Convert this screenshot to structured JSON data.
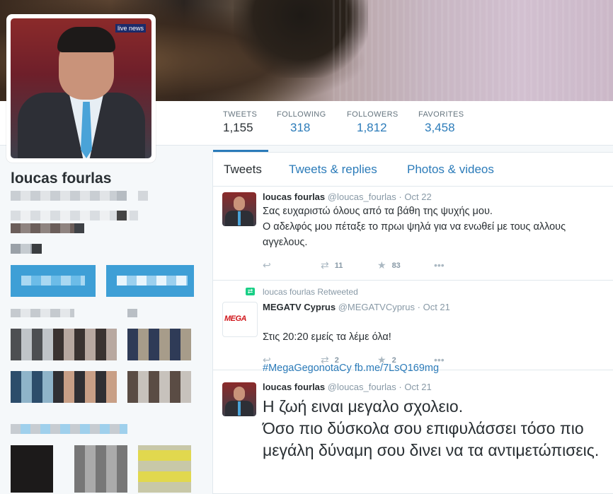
{
  "profile": {
    "name": "loucas fourlas",
    "avatar_logo": "live news"
  },
  "stats": [
    {
      "label": "TWEETS",
      "value": "1,155"
    },
    {
      "label": "FOLLOWING",
      "value": "318"
    },
    {
      "label": "FOLLOWERS",
      "value": "1,812"
    },
    {
      "label": "FAVORITES",
      "value": "3,458"
    }
  ],
  "tabs": [
    "Tweets",
    "Tweets & replies",
    "Photos & videos"
  ],
  "tweets": [
    {
      "name": "loucas fourlas",
      "handle": "@loucas_fourlas",
      "sep": "·",
      "date": "Oct 22",
      "text": "Σας ευχαριστώ όλους από τα βάθη της ψυχής μου.\nΟ αδελφός μου πέταξε το πρωι ψηλά  για να ενωθεί με τους αλλους αγγελους.",
      "retweets": "11",
      "favorites": "83"
    },
    {
      "retweeted_by": "loucas fourlas Retweeted",
      "name": "MEGATV Cyprus",
      "handle": "@MEGATVCyprus",
      "sep": "·",
      "date": "Oct 21",
      "avatar_text": "MEGA",
      "text": "Στις 20:20 εμείς τα λέμε όλα!",
      "link": "#MegaGegonotaCy fb.me/7LsQ169mg",
      "retweets": "2",
      "favorites": "2"
    },
    {
      "name": "loucas fourlas",
      "handle": "@loucas_fourlas",
      "sep": "·",
      "date": "Oct 21",
      "text": "Η ζωή ειναι μεγαλο σχολειο.\nΌσο πιο δύσκολα σου επιφυλάσσει τόσο πιο μεγάλη δύναμη σου δινει να τα αντιμετώπισεις."
    }
  ],
  "icons": {
    "reply": "reply-icon",
    "retweet": "retweet-icon",
    "favorite": "star-icon",
    "more": "more-icon"
  },
  "colors": {
    "link": "#2b7bb9",
    "accent_bar": "#2b7bb9",
    "retweet_green": "#19cf86"
  }
}
